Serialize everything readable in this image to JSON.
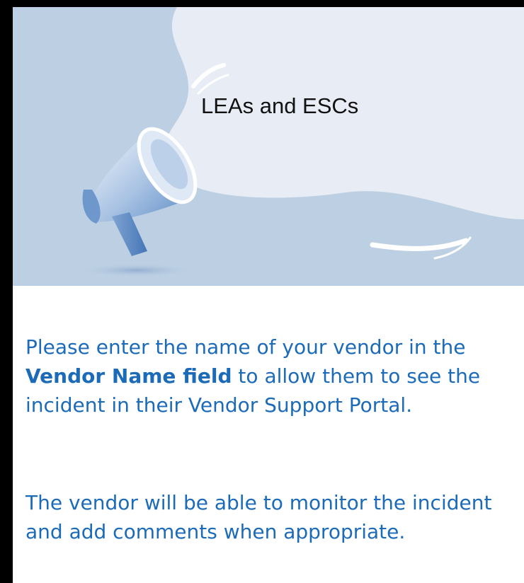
{
  "hero": {
    "title": "LEAs and ESCs",
    "icon": "megaphone-icon"
  },
  "paragraph1": {
    "before": "Please enter the name of your vendor in the ",
    "bold": "Vendor Name field",
    "after": " to allow them to see the incident in their Vendor Support Portal."
  },
  "paragraph2": {
    "text": "The vendor will be able to monitor the incident and add comments when appropriate."
  },
  "colors": {
    "text": "#1c6bb8",
    "hero_bg": "#bdd0e3",
    "bubble": "#e8edf5"
  }
}
